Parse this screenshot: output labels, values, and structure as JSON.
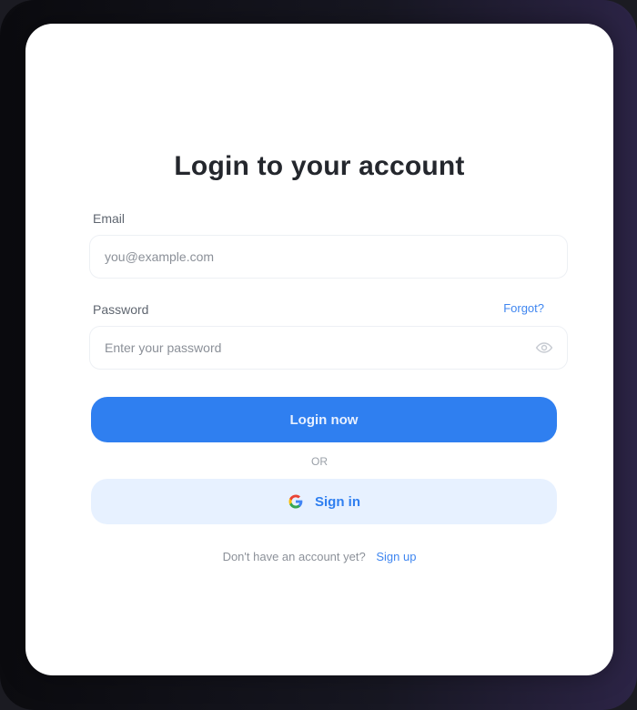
{
  "login": {
    "title": "Login to your account",
    "email_label": "Email",
    "email_placeholder": "you@example.com",
    "password_label": "Password",
    "forgot_link": "Forgot?",
    "password_placeholder": "Enter your password",
    "login_button": "Login now",
    "divider_text": "OR",
    "google_button": "Sign in",
    "footer_text": "Don't have an account yet?",
    "signup_link": "Sign up"
  },
  "icons": {
    "eye": "eye-icon",
    "google": "google-icon"
  },
  "colors": {
    "accent": "#2f7ff0",
    "accent_light": "#e7f1ff",
    "title": "#24272d"
  }
}
